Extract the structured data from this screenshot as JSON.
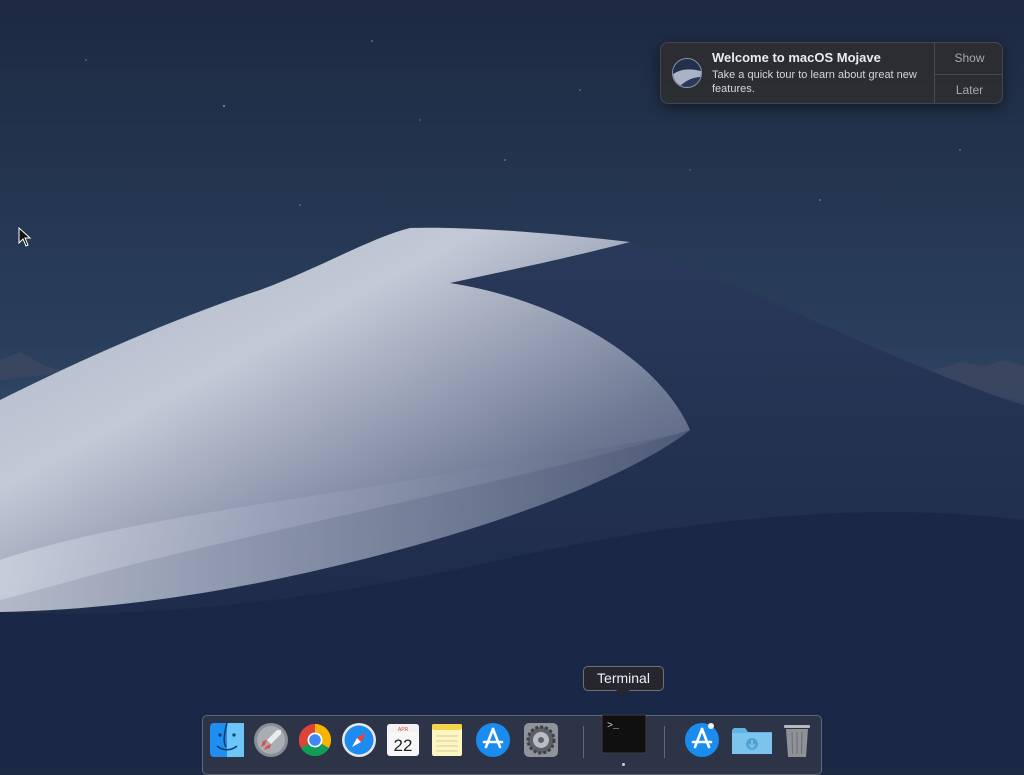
{
  "notification": {
    "title": "Welcome to macOS Mojave",
    "body": "Take a quick tour to learn about great new features.",
    "actions": [
      "Show",
      "Later"
    ]
  },
  "tooltip": {
    "label": "Terminal"
  },
  "dock": {
    "items": [
      {
        "name": "Finder",
        "icon": "finder-icon",
        "running": false
      },
      {
        "name": "Launchpad",
        "icon": "launchpad-icon",
        "running": false
      },
      {
        "name": "Google Chrome",
        "icon": "chrome-icon",
        "running": false
      },
      {
        "name": "Safari",
        "icon": "safari-icon",
        "running": false
      },
      {
        "name": "Calendar",
        "icon": "calendar-icon",
        "running": false,
        "month": "APR",
        "day": "22"
      },
      {
        "name": "Notes",
        "icon": "notes-icon",
        "running": false
      },
      {
        "name": "App Store",
        "icon": "app-store-icon",
        "running": false
      },
      {
        "name": "System Preferences",
        "icon": "system-preferences-icon",
        "running": false
      },
      {
        "name": "Terminal",
        "icon": "terminal-icon",
        "running": true,
        "prompt": ">_"
      },
      {
        "name": "App Store",
        "icon": "app-store-icon",
        "running": false
      },
      {
        "name": "Downloads",
        "icon": "downloads-folder-icon",
        "running": false
      },
      {
        "name": "Trash",
        "icon": "trash-icon",
        "running": false
      }
    ]
  },
  "colors": {
    "sky": "#1c2a44",
    "dune_light": "#c9cdd8",
    "dune_dark": "#1e2b4a",
    "notification_bg": "#2c2e32",
    "accent_blue": "#1a8cf0"
  }
}
